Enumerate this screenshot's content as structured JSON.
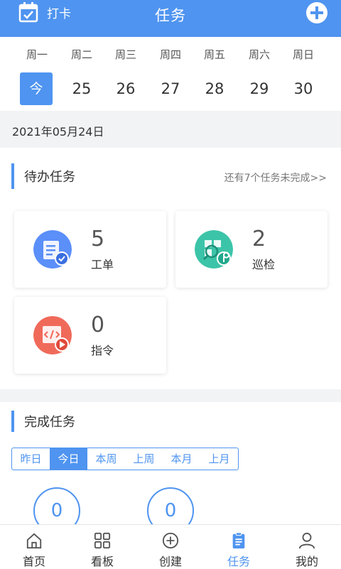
{
  "header": {
    "checkin_label": "打卡",
    "title": "任务"
  },
  "week": {
    "day_names": [
      "周一",
      "周二",
      "周三",
      "周四",
      "周五",
      "周六",
      "周日"
    ],
    "days": [
      "今",
      "25",
      "26",
      "27",
      "28",
      "29",
      "30"
    ],
    "active_index": 0
  },
  "date_label": "2021年05月24日",
  "pending": {
    "title": "待办任务",
    "more": "还有7个任务未完成>>",
    "cards": [
      {
        "count": "5",
        "label": "工单",
        "icon": "work-order-icon",
        "color": "#5b8ff9"
      },
      {
        "count": "2",
        "label": "巡检",
        "icon": "inspection-icon",
        "color": "#3cc4a8"
      },
      {
        "count": "0",
        "label": "指令",
        "icon": "command-icon",
        "color": "#f06a5a"
      }
    ]
  },
  "done": {
    "title": "完成任务",
    "tabs": [
      "昨日",
      "今日",
      "本周",
      "上周",
      "本月",
      "上月"
    ],
    "active_tab": 1,
    "counts": [
      "0",
      "0"
    ]
  },
  "tabbar": {
    "items": [
      "首页",
      "看板",
      "创建",
      "任务",
      "我的"
    ],
    "active_index": 3
  },
  "colors": {
    "accent": "#4f94f0"
  }
}
